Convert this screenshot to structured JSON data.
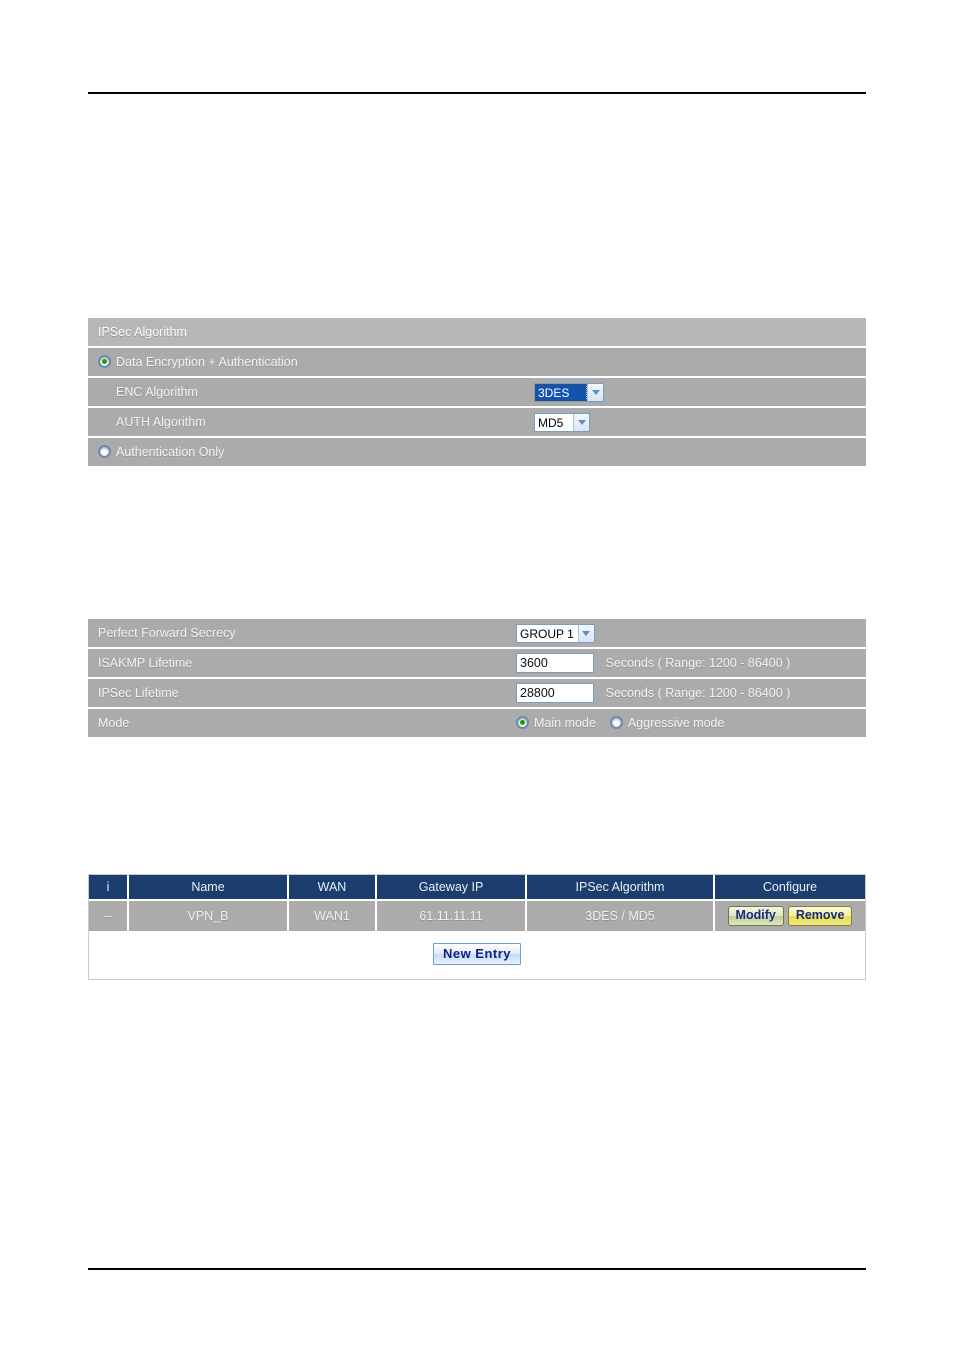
{
  "page": {
    "rules": {
      "top": true,
      "bottom": true
    }
  },
  "ipsec_algorithm_table": {
    "header": "IPSec Algorithm",
    "option_data_enc_auth": {
      "label": "Data Encryption + Authentication",
      "selected": true
    },
    "enc_algorithm": {
      "label": "ENC Algorithm",
      "value": "3DES",
      "focused": true
    },
    "auth_algorithm": {
      "label": "AUTH Algorithm",
      "value": "MD5",
      "focused": false
    },
    "option_auth_only": {
      "label": "Authentication Only",
      "selected": false
    }
  },
  "ike_settings_table": {
    "pfs": {
      "label": "Perfect Forward Secrecy",
      "value": "GROUP 1"
    },
    "isakmp_lifetime": {
      "label": "ISAKMP Lifetime",
      "value": "3600",
      "unit": "Seconds  ( Range: 1200 - 86400 )"
    },
    "ipsec_lifetime": {
      "label": "IPSec Lifetime",
      "value": "28800",
      "unit": "Seconds  ( Range: 1200 - 86400 )"
    },
    "mode": {
      "label": "Mode",
      "main_label": "Main mode",
      "main_selected": true,
      "aggressive_label": "Aggressive mode",
      "aggressive_selected": false
    }
  },
  "vpn_list": {
    "columns": [
      "i",
      "Name",
      "WAN",
      "Gateway IP",
      "IPSec Algorithm",
      "Configure"
    ],
    "rows": [
      {
        "i": "--",
        "name": "VPN_B",
        "wan": "WAN1",
        "gateway_ip": "61.11.11.11",
        "ipsec_algorithm": "3DES / MD5",
        "modify_label": "Modify",
        "remove_label": "Remove"
      }
    ],
    "new_entry_label": "New  Entry"
  },
  "colors": {
    "row_gray": "#ababab",
    "header_gray": "#b7b7b7",
    "list_header_navy": "#1b3e6f",
    "select_highlight": "#1352ad",
    "radio_dot_green": "#17a017"
  }
}
